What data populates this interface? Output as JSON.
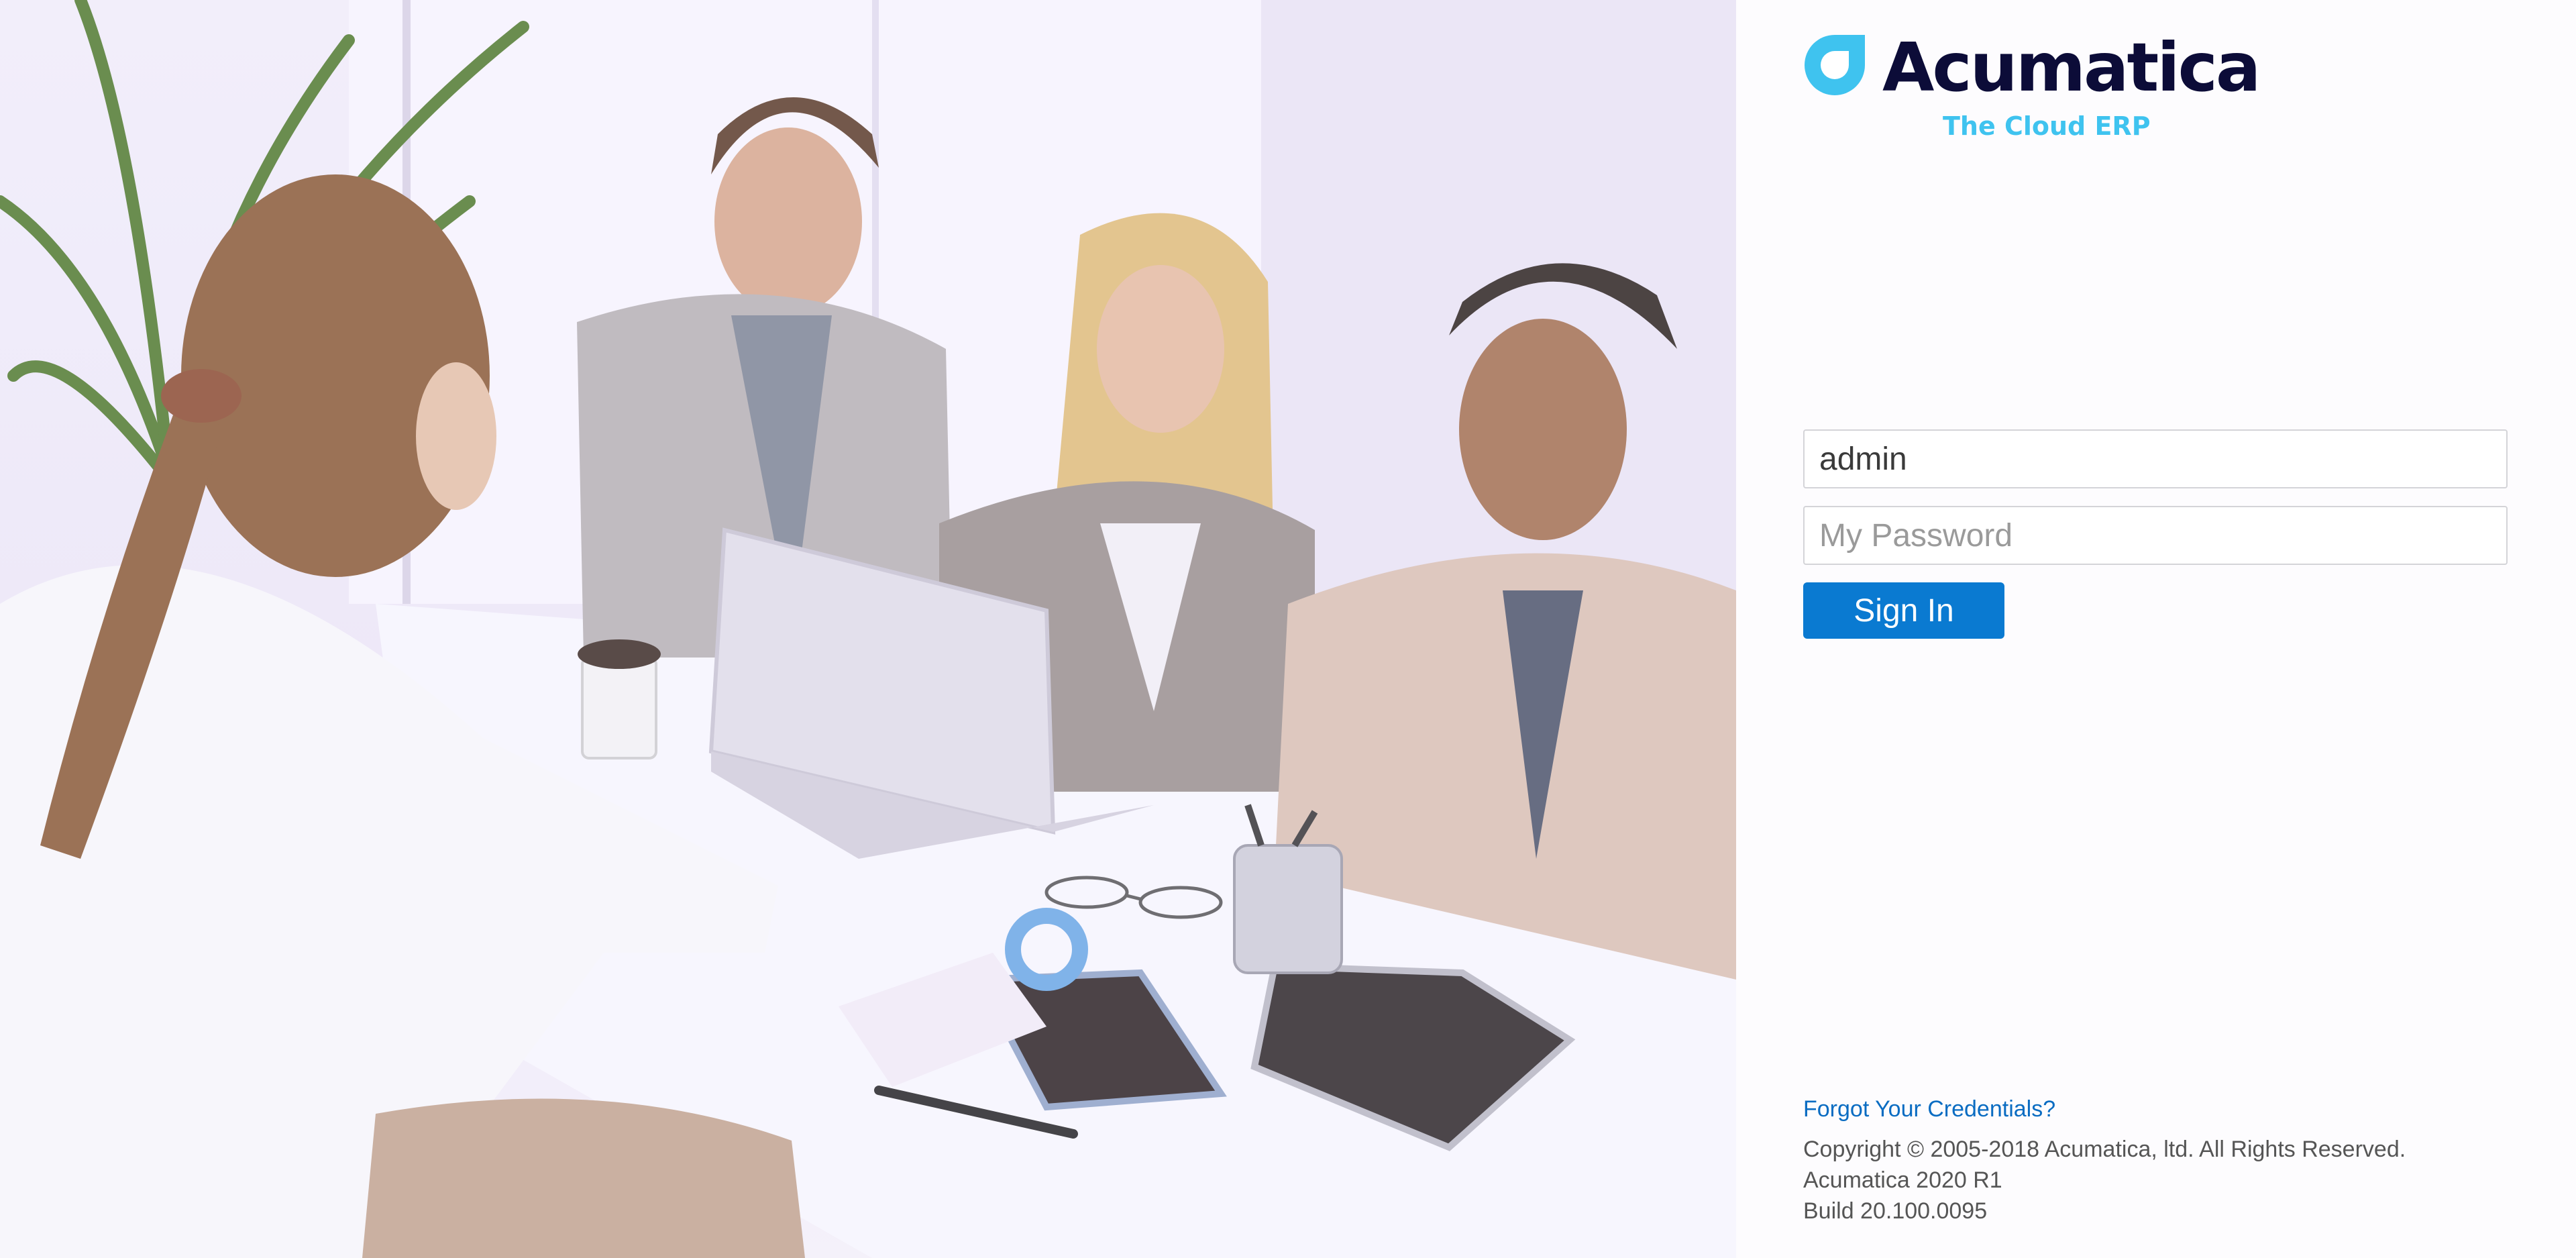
{
  "brand": {
    "name": "Acumatica",
    "tagline": "The Cloud ERP",
    "logo_icon": "acumatica-logo-icon",
    "colors": {
      "wordmark": "#0c0c38",
      "accent": "#3fc3ef"
    }
  },
  "hero_image": {
    "icon": "office-meeting-photo"
  },
  "login": {
    "username_value": "admin",
    "password_placeholder": "My Password",
    "sign_in_label": "Sign In",
    "button_color": "#0a7ad1"
  },
  "footer": {
    "forgot_link": "Forgot Your Credentials?",
    "copyright": "Copyright © 2005-2018 Acumatica, ltd. All Rights Reserved.",
    "version": "Acumatica 2020 R1",
    "build": "Build 20.100.0095"
  }
}
